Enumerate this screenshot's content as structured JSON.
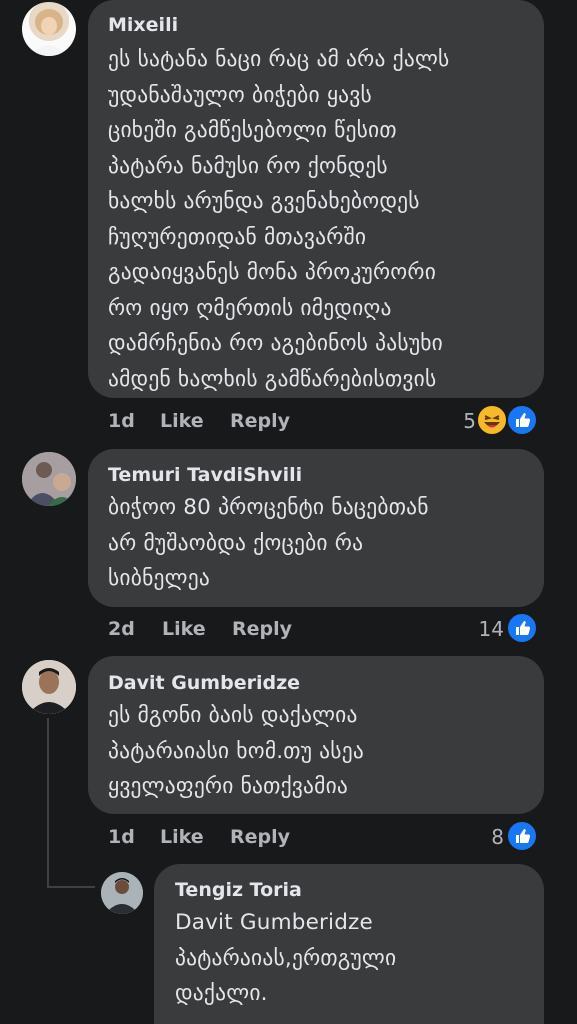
{
  "comments": [
    {
      "author": "Mixeili",
      "text": "ეს სატანა ნაცი რაც ამ არა ქალს\nუდანაშაულო ბიჭები ყავს\nციხეში გამწესებოლი წესით\nპატარა ნამუსი რო ქონდეს\nხალხს არუნდა გვენახებოდეს\nჩუღურეთიდან მთავარში\nგადაიყვანეს მონა პროკურორი\nრო იყო ღმერთის იმედიღა\nდამრჩენია რო აგებინოს პასუხი\nამდენ ხალხის გამწარებისთვის",
      "time": "1d",
      "like": "Like",
      "reply": "Reply",
      "reactions": "5",
      "reaction_types": [
        "haha-icon",
        "like-icon"
      ]
    },
    {
      "author": "Temuri TavdiShvili",
      "text": "ბიჭოო 80 პროცენტი ნაცებთან\nარ მუშაობდა ქოცები რა\nსიბნელეა",
      "time": "2d",
      "like": "Like",
      "reply": "Reply",
      "reactions": "14",
      "reaction_types": [
        "like-icon"
      ]
    },
    {
      "author": "Davit Gumberidze",
      "text": "ეს მგონი ბაის დაქალია\nპატარაიასი ხომ.თუ ასეა\nყველაფერი ნათქვამია",
      "time": "1d",
      "like": "Like",
      "reply": "Reply",
      "reactions": "8",
      "reaction_types": [
        "like-icon"
      ]
    },
    {
      "author": "Tengiz Toria",
      "text": "Davit Gumberidze\nპატარაიას,ერთგული\nდაქალი."
    }
  ],
  "colors": {
    "background": "#18191a",
    "bubble": "#3a3b3c",
    "like_blue": "#1877f2",
    "haha_yellow": "#f7b928",
    "meta_gray": "#b0b3b8"
  }
}
